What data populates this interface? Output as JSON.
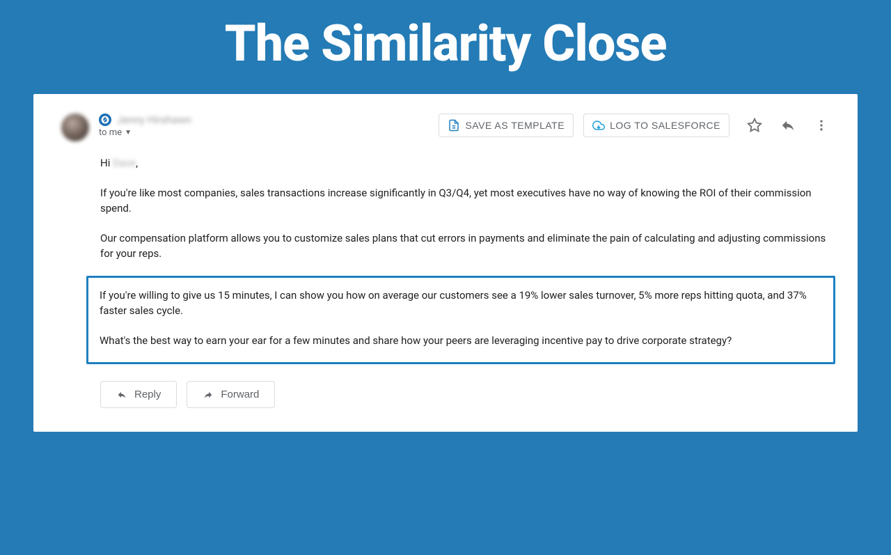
{
  "page": {
    "title": "The Similarity Close"
  },
  "email": {
    "sender_name": "Jenny Hirshawn",
    "recipient_line": "to me",
    "greeting_prefix": "Hi ",
    "greeting_name": "Dave",
    "greeting_suffix": ",",
    "para1": "If you're like most companies, sales transactions increase significantly in Q3/Q4, yet most executives have no way of knowing the ROI of their commission spend.",
    "para2": "Our compensation platform allows you to customize sales plans that cut errors in payments and eliminate the pain of calculating and adjusting commissions for your reps.",
    "para3": "If you're willing to give us 15 minutes, I can show you how on average our customers see a 19% lower sales turnover, 5% more reps hitting quota, and 37% faster sales cycle.",
    "para4": "What's the best way to earn your ear for a few minutes and share how your peers are leveraging incentive pay to drive corporate strategy?"
  },
  "actions": {
    "save_template": "SAVE AS TEMPLATE",
    "log_salesforce": "LOG TO SALESFORCE",
    "reply": "Reply",
    "forward": "Forward"
  }
}
